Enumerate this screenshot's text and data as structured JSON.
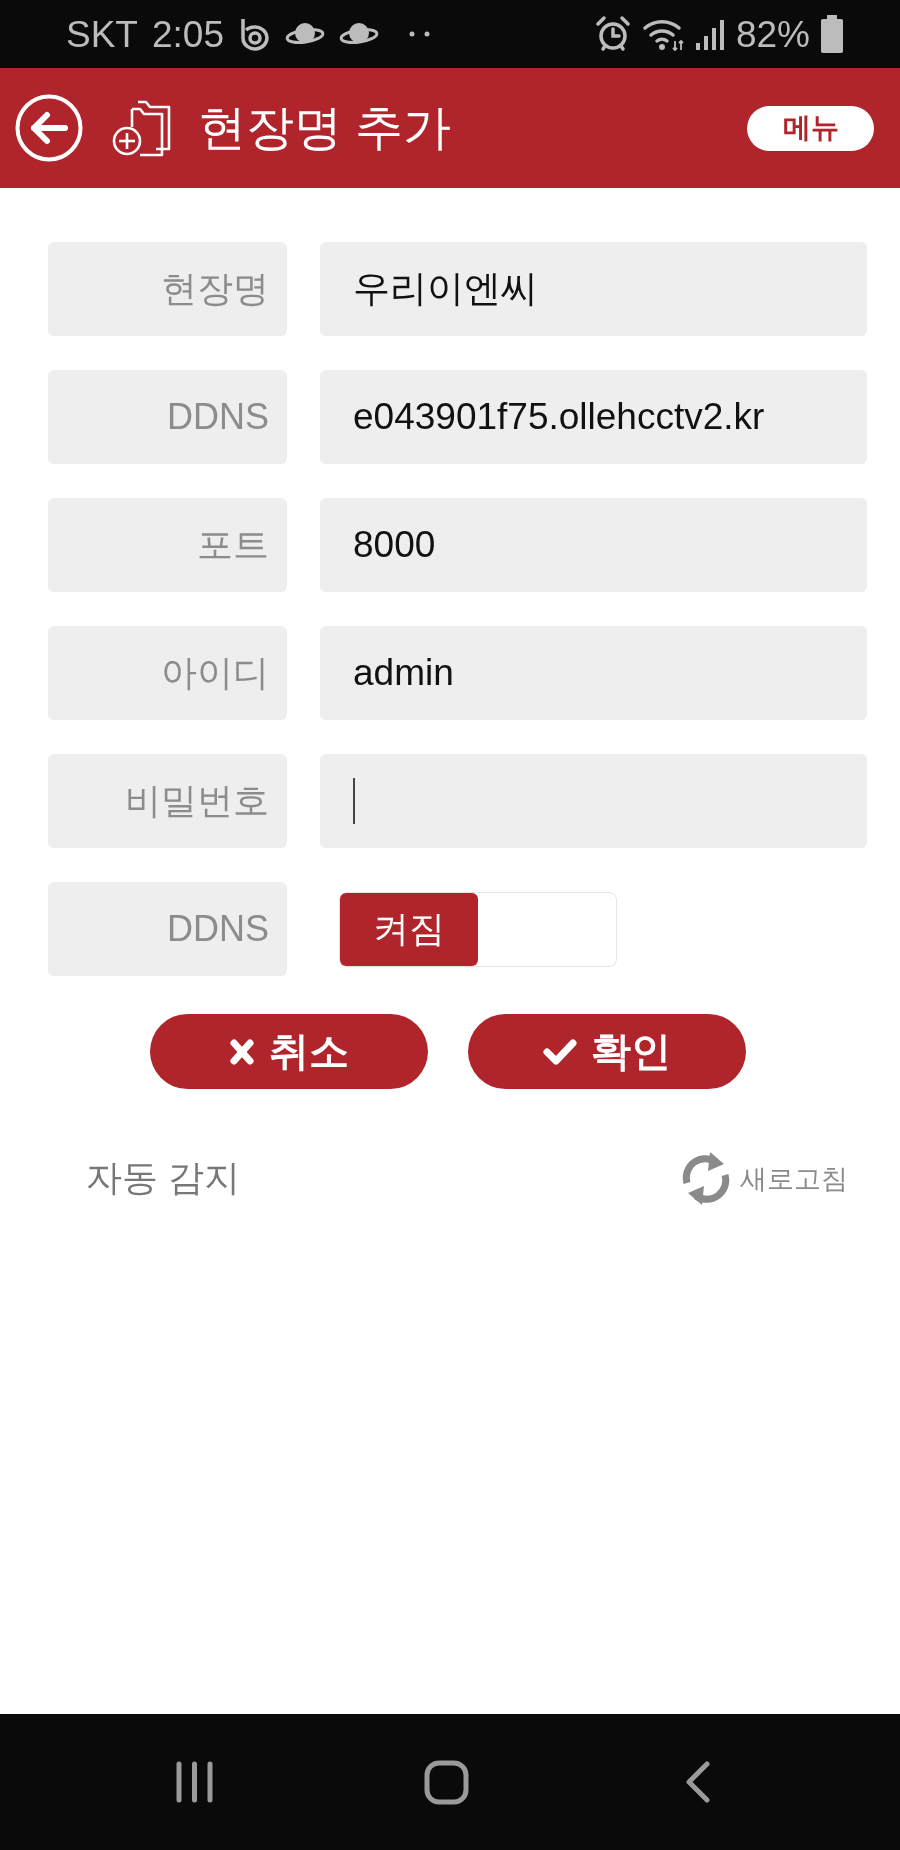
{
  "status_bar": {
    "carrier": "SKT",
    "time": "2:05",
    "battery": "82%"
  },
  "header": {
    "title": "현장명 추가",
    "menu_button": "메뉴"
  },
  "form": {
    "fields": [
      {
        "kind": "text",
        "label": "현장명",
        "value": "우리이엔씨",
        "focused": false
      },
      {
        "kind": "text",
        "label": "DDNS",
        "value": "e043901f75.ollehcctv2.kr",
        "focused": false
      },
      {
        "kind": "text",
        "label": "포트",
        "value": "8000",
        "focused": false
      },
      {
        "kind": "text",
        "label": "아이디",
        "value": "admin",
        "focused": false
      },
      {
        "kind": "password",
        "label": "비밀번호",
        "focused": true
      },
      {
        "kind": "toggle",
        "label": "DDNS",
        "state_text": "켜짐",
        "on": true
      }
    ]
  },
  "buttons": [
    {
      "kind": "cancel",
      "label": "취소"
    },
    {
      "kind": "confirm",
      "label": "확인"
    }
  ],
  "auto_detect": {
    "title": "자동 감지",
    "refresh_label": "새로고침"
  }
}
